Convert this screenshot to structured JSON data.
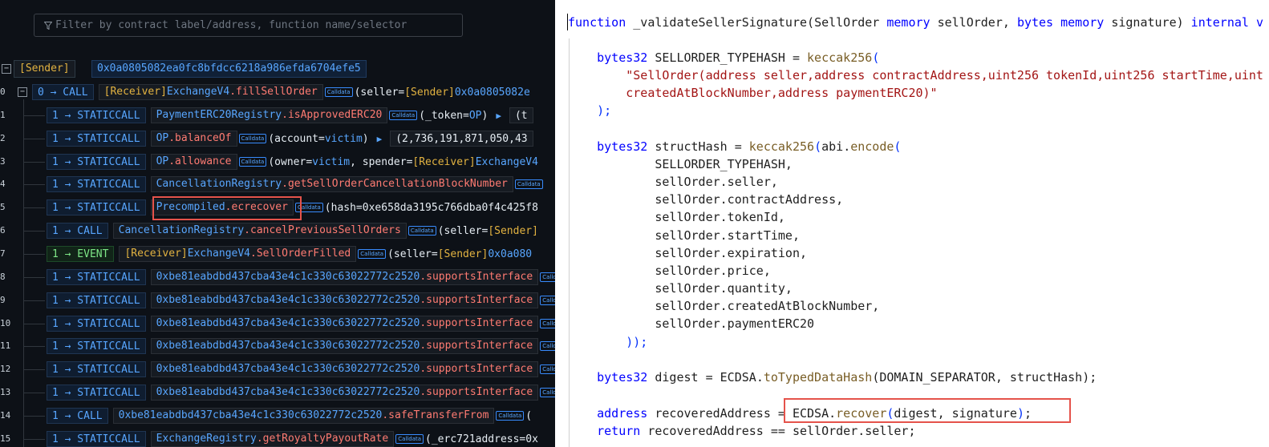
{
  "filter": {
    "placeholder": "Filter by contract label/address, function name/selector"
  },
  "sender": {
    "tag": "[Sender]",
    "address": "0x0a0805082ea0fc8bfdcc6218a986efda6704efe5"
  },
  "calldata_label": "Calldata",
  "trace": [
    {
      "num": "0",
      "depth": "0",
      "type": "CALL",
      "parts": [
        [
          "[Receiver] ",
          "sender"
        ],
        [
          "ExchangeV4",
          "blue"
        ],
        [
          ".fillSellOrder",
          "fn"
        ]
      ],
      "args": "(seller=",
      "args2": "[Sender]",
      "args3": "0x0a0805082e"
    },
    {
      "num": "1",
      "depth": "1",
      "type": "STATICCALL",
      "parts": [
        [
          "PaymentERC20Registry",
          "blue"
        ],
        [
          ".isApprovedERC20",
          "fn"
        ]
      ],
      "args": "(_token=",
      "args2": "OP",
      "args3": ")",
      "ret": "(t"
    },
    {
      "num": "2",
      "depth": "1",
      "type": "STATICCALL",
      "parts": [
        [
          "OP",
          "blue"
        ],
        [
          ".balanceOf",
          "fn"
        ]
      ],
      "args": "(account=",
      "args2": "victim",
      "args3": ")",
      "ret": "(2,736,191,871,050,43"
    },
    {
      "num": "3",
      "depth": "1",
      "type": "STATICCALL",
      "parts": [
        [
          "OP",
          "blue"
        ],
        [
          ".allowance",
          "fn"
        ]
      ],
      "args": "(owner=",
      "args2": "victim",
      "args3": ", spender=",
      "args4": "[Receiver]",
      "args5": "ExchangeV4"
    },
    {
      "num": "4",
      "depth": "1",
      "type": "STATICCALL",
      "parts": [
        [
          "CancellationRegistry",
          "blue"
        ],
        [
          ".getSellOrderCancellationBlockNumber",
          "fn"
        ]
      ],
      "args": ""
    },
    {
      "num": "5",
      "depth": "1",
      "type": "STATICCALL",
      "parts": [
        [
          "Precompiled",
          "blue"
        ],
        [
          ".ecrecover",
          "fn"
        ]
      ],
      "args": "(hash=0xe658da3195c766dba0f4c425f8"
    },
    {
      "num": "6",
      "depth": "1",
      "type": "CALL",
      "parts": [
        [
          "CancellationRegistry",
          "blue"
        ],
        [
          ".cancelPreviousSellOrders",
          "fn"
        ]
      ],
      "args": "(seller=",
      "args2": "[Sender]"
    },
    {
      "num": "7",
      "depth": "1",
      "type": "EVENT",
      "parts": [
        [
          "[Receiver] ",
          "sender"
        ],
        [
          "ExchangeV4",
          "blue"
        ],
        [
          ".SellOrderFilled",
          "fn"
        ]
      ],
      "args": "(seller=",
      "args2": "[Sender]",
      "args3": "0x0a080"
    },
    {
      "num": "8",
      "depth": "1",
      "type": "STATICCALL",
      "parts": [
        [
          "0xbe81eabdbd437cba43e4c1c330c63022772c2520",
          "blue"
        ],
        [
          ".supportsInterface",
          "fn"
        ]
      ],
      "args": ""
    },
    {
      "num": "9",
      "depth": "1",
      "type": "STATICCALL",
      "parts": [
        [
          "0xbe81eabdbd437cba43e4c1c330c63022772c2520",
          "blue"
        ],
        [
          ".supportsInterface",
          "fn"
        ]
      ],
      "args": ""
    },
    {
      "num": "10",
      "depth": "1",
      "type": "STATICCALL",
      "parts": [
        [
          "0xbe81eabdbd437cba43e4c1c330c63022772c2520",
          "blue"
        ],
        [
          ".supportsInterface",
          "fn"
        ]
      ],
      "args": ""
    },
    {
      "num": "11",
      "depth": "1",
      "type": "STATICCALL",
      "parts": [
        [
          "0xbe81eabdbd437cba43e4c1c330c63022772c2520",
          "blue"
        ],
        [
          ".supportsInterface",
          "fn"
        ]
      ],
      "args": ""
    },
    {
      "num": "12",
      "depth": "1",
      "type": "STATICCALL",
      "parts": [
        [
          "0xbe81eabdbd437cba43e4c1c330c63022772c2520",
          "blue"
        ],
        [
          ".supportsInterface",
          "fn"
        ]
      ],
      "args": ""
    },
    {
      "num": "13",
      "depth": "1",
      "type": "STATICCALL",
      "parts": [
        [
          "0xbe81eabdbd437cba43e4c1c330c63022772c2520",
          "blue"
        ],
        [
          ".supportsInterface",
          "fn"
        ]
      ],
      "args": ""
    },
    {
      "num": "14",
      "depth": "1",
      "type": "CALL",
      "parts": [
        [
          "0xbe81eabdbd437cba43e4c1c330c63022772c2520",
          "blue"
        ],
        [
          ".safeTransferFrom",
          "fn"
        ]
      ],
      "args": "("
    },
    {
      "num": "15",
      "depth": "1",
      "type": "STATICCALL",
      "parts": [
        [
          "ExchangeRegistry",
          "blue"
        ],
        [
          ".getRoyaltyPayoutRate",
          "fn"
        ]
      ],
      "args": "(_erc721address=0x"
    }
  ],
  "code": [
    [
      [
        "function",
        "k"
      ],
      [
        " _validateSellerSignature(",
        "d"
      ],
      [
        "SellOrder",
        "d"
      ],
      [
        " memory",
        "k"
      ],
      [
        " sellOrder, ",
        "d"
      ],
      [
        "bytes",
        "k"
      ],
      [
        " memory",
        "k"
      ],
      [
        " signature",
        "d"
      ],
      [
        ")",
        "d"
      ],
      [
        " internal",
        "k"
      ],
      [
        " v",
        "k"
      ]
    ],
    [],
    [
      [
        "    bytes32",
        "k"
      ],
      [
        " SELLORDER_TYPEHASH = ",
        "d"
      ],
      [
        "keccak256",
        "f"
      ],
      [
        "(",
        "p"
      ]
    ],
    [
      [
        "        \"SellOrder(address seller,address contractAddress,uint256 tokenId,uint256 startTime,uint",
        "s"
      ]
    ],
    [
      [
        "        createdAtBlockNumber,address paymentERC20)\"",
        "s"
      ]
    ],
    [
      [
        "    );",
        "p"
      ]
    ],
    [],
    [
      [
        "    bytes32",
        "k"
      ],
      [
        " structHash = ",
        "d"
      ],
      [
        "keccak256",
        "f"
      ],
      [
        "(",
        "p"
      ],
      [
        "abi",
        "d"
      ],
      [
        ".",
        "d"
      ],
      [
        "encode",
        "f"
      ],
      [
        "(",
        "p"
      ]
    ],
    [
      [
        "            SELLORDER_TYPEHASH,",
        "d"
      ]
    ],
    [
      [
        "            sellOrder.seller,",
        "d"
      ]
    ],
    [
      [
        "            sellOrder.contractAddress,",
        "d"
      ]
    ],
    [
      [
        "            sellOrder.tokenId,",
        "d"
      ]
    ],
    [
      [
        "            sellOrder.startTime,",
        "d"
      ]
    ],
    [
      [
        "            sellOrder.expiration,",
        "d"
      ]
    ],
    [
      [
        "            sellOrder.price,",
        "d"
      ]
    ],
    [
      [
        "            sellOrder.quantity,",
        "d"
      ]
    ],
    [
      [
        "            sellOrder.createdAtBlockNumber,",
        "d"
      ]
    ],
    [
      [
        "            sellOrder.paymentERC20",
        "d"
      ]
    ],
    [
      [
        "        ));",
        "p"
      ]
    ],
    [],
    [
      [
        "    bytes32",
        "k"
      ],
      [
        " digest = ",
        "d"
      ],
      [
        "ECDSA",
        "d"
      ],
      [
        ".",
        "d"
      ],
      [
        "toTypedDataHash",
        "f"
      ],
      [
        "(",
        "d"
      ],
      [
        "DOMAIN_SEPARATOR, structHash",
        "d"
      ],
      [
        ");",
        "d"
      ]
    ],
    [],
    [
      [
        "    address",
        "k"
      ],
      [
        " recoveredAddress = ",
        "d"
      ],
      [
        "ECDSA",
        "d"
      ],
      [
        ".",
        "d"
      ],
      [
        "recover",
        "f"
      ],
      [
        "(",
        "p"
      ],
      [
        "digest, signature",
        "d"
      ],
      [
        ")",
        "p"
      ],
      [
        ";",
        "d"
      ]
    ],
    [
      [
        "    return",
        "k"
      ],
      [
        " recoveredAddress == sellOrder.seller;",
        "d"
      ]
    ]
  ]
}
